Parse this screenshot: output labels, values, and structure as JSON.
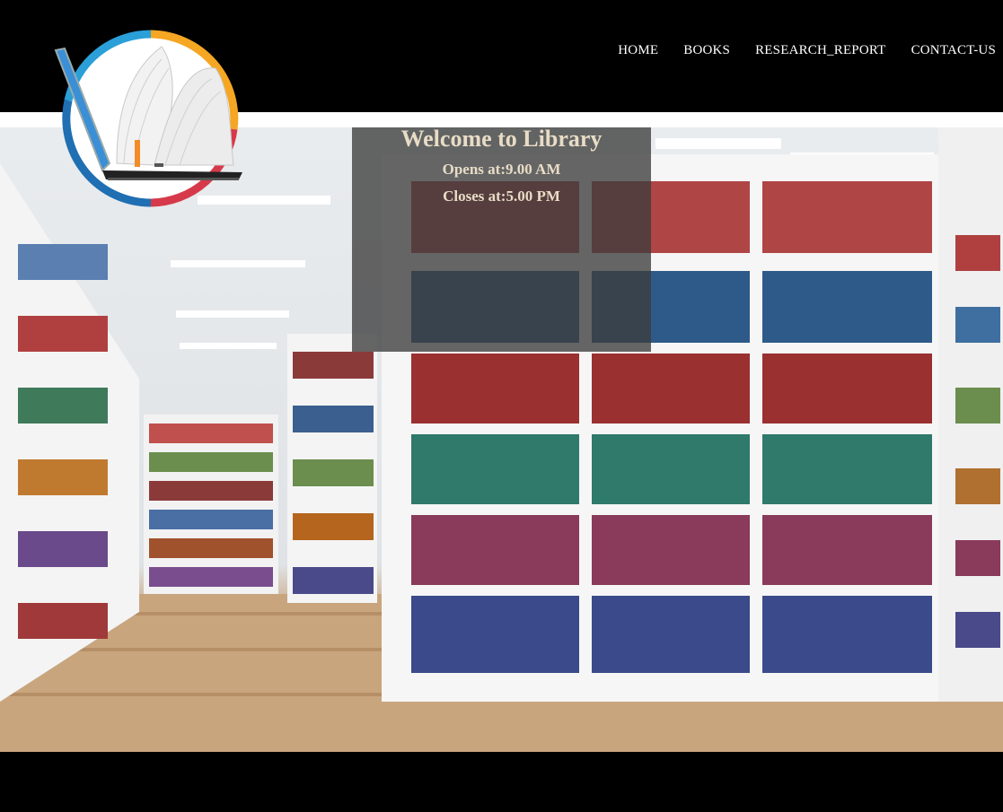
{
  "nav": {
    "items": [
      {
        "label": "HOME"
      },
      {
        "label": "BOOKS"
      },
      {
        "label": "RESEARCH_REPORT"
      },
      {
        "label": "CONTACT-US"
      }
    ]
  },
  "logo": {
    "icon": "open-book-laptop-logo"
  },
  "hero": {
    "image": "library-bookshelves-photo",
    "welcome_title": "Welcome to Library",
    "opens": "Opens at:9.00 AM",
    "closes": "Closes at:5.00 PM"
  },
  "colors": {
    "background": "#000000",
    "text_overlay": "#e8dcc6",
    "logo_ring_orange": "#f5a623",
    "logo_ring_red": "#d63a4a",
    "logo_ring_blue": "#2a8fd0"
  }
}
